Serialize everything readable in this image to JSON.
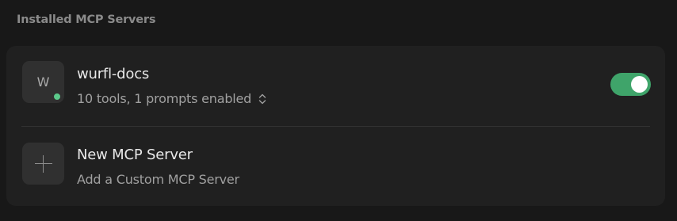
{
  "section": {
    "title": "Installed MCP Servers"
  },
  "servers": [
    {
      "avatar_letter": "W",
      "name": "wurfl-docs",
      "summary": "10 tools, 1 prompts enabled",
      "status": "connected",
      "status_color": "#5bc98a",
      "enabled": true,
      "toggle_color": "#3fa46a"
    }
  ],
  "new_server": {
    "title": "New MCP Server",
    "subtitle": "Add a Custom MCP Server",
    "icon": "plus-icon"
  }
}
